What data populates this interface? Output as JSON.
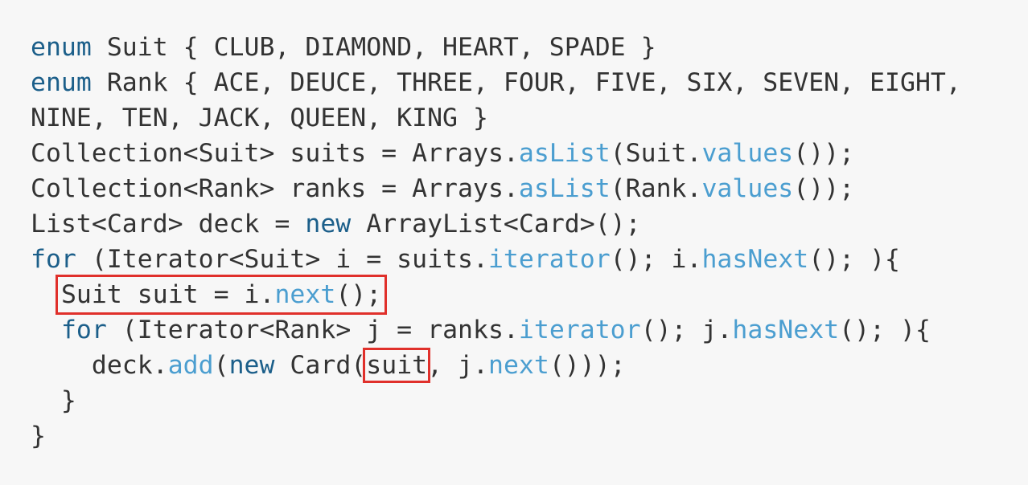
{
  "code": {
    "line1": {
      "kw": "enum",
      "rest": " Suit { CLUB, DIAMOND, HEART, SPADE }"
    },
    "line2": {
      "kw": "enum",
      "rest": " Rank { ACE, DEUCE, THREE, FOUR, FIVE, SIX, SEVEN, EIGHT,"
    },
    "line3": {
      "text": "NINE, TEN, JACK, QUEEN, KING }"
    },
    "line4": {
      "a": "Collection<Suit> suits = Arrays.",
      "fn1": "asList",
      "b": "(Suit.",
      "fn2": "values",
      "c": "());"
    },
    "line5": {
      "a": "Collection<Rank> ranks = Arrays.",
      "fn1": "asList",
      "b": "(Rank.",
      "fn2": "values",
      "c": "());"
    },
    "line6": {
      "a": "List<Card> deck = ",
      "kw": "new",
      "b": " ArrayList<Card>();"
    },
    "line7": {
      "kw": "for",
      "a": " (Iterator<Suit> i = suits.",
      "fn1": "iterator",
      "b": "(); i.",
      "fn2": "hasNext",
      "c": "(); ){"
    },
    "line8": {
      "indent": "  ",
      "a": "Suit suit = i.",
      "fn": "next",
      "b": "();"
    },
    "line9": {
      "indent": "  ",
      "kw": "for",
      "a": " (Iterator<Rank> j = ranks.",
      "fn1": "iterator",
      "b": "(); j.",
      "fn2": "hasNext",
      "c": "(); ){"
    },
    "line10": {
      "indent": "    ",
      "a": "deck.",
      "fn1": "add",
      "b": "(",
      "kw": "new",
      "c": " Card(",
      "arg": "suit",
      "d": ", j.",
      "fn2": "next",
      "e": "()));"
    },
    "line11": {
      "text": "  }"
    },
    "line12": {
      "text": "}"
    }
  },
  "colors": {
    "background": "#f7f7f7",
    "text": "#333333",
    "keyword": "#1c5f8a",
    "method": "#4b9ed0",
    "highlight_box": "#e0302b"
  }
}
